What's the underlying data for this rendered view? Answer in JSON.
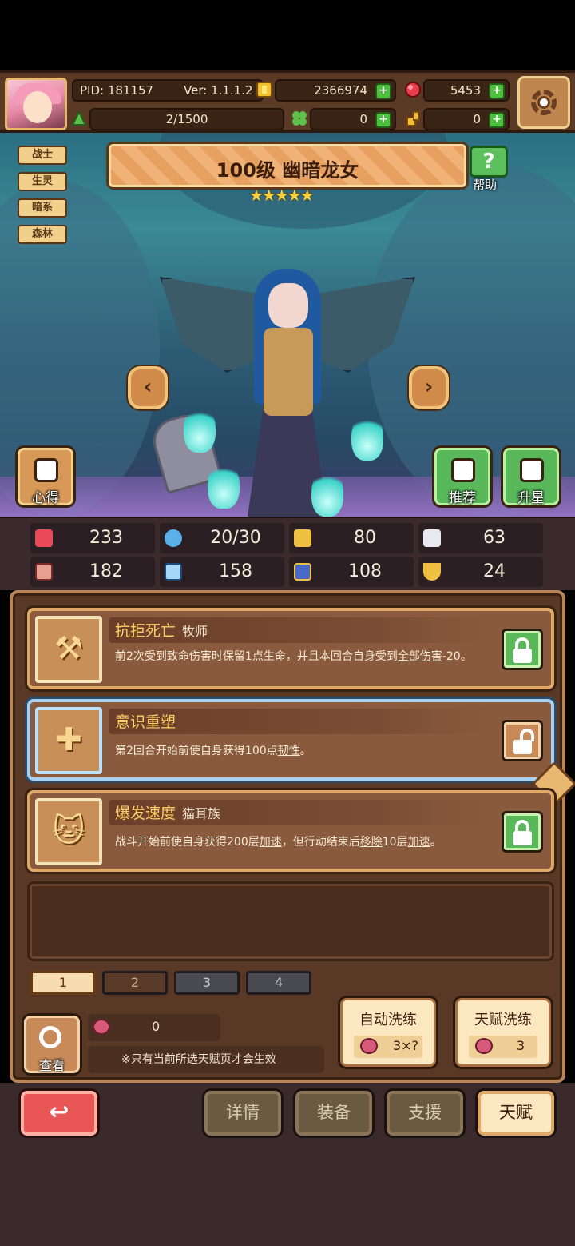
{
  "topbar": {
    "pid": "PID: 181157",
    "version": "Ver: 1.1.1.2",
    "gold": "2366974",
    "gems": "5453",
    "energy": "2/1500",
    "clover": "0",
    "key": "0"
  },
  "hero": {
    "tags": [
      "战士",
      "生灵",
      "暗系",
      "森林"
    ],
    "title": "100级  幽暗龙女",
    "stars": "★★★★★",
    "help_label": "帮助",
    "prev_arrow": "‹",
    "next_arrow": "›",
    "xinde_label": "心得",
    "recommend_label": "推荐",
    "starup_label": "升星"
  },
  "stats": {
    "hp": "233",
    "mana": "20/30",
    "armor": "80",
    "speed": "63",
    "attack": "182",
    "magic": "158",
    "shield": "108",
    "luck": "24"
  },
  "talents": [
    {
      "name": "抗拒死亡",
      "tribe": "牧师",
      "glyph": "⚒",
      "desc_a": "前2次受到致命伤害时保留1点生命，并且本回合自身受到",
      "desc_u": "全部伤害",
      "desc_b": "-20。",
      "locked": "green"
    },
    {
      "name": "意识重塑",
      "tribe": "",
      "glyph": "✚",
      "desc_a": "第2回合开始前使自身获得100点",
      "desc_u": "韧性",
      "desc_b": "。",
      "locked": "open"
    },
    {
      "name": "爆发速度",
      "tribe": "猫耳族",
      "glyph": "🐱",
      "desc_a": "战斗开始前使自身获得200层",
      "desc_u": "加速",
      "desc_b": "，但行动结束后",
      "desc_u2": "移除",
      "desc_c": "10层",
      "desc_u3": "加速",
      "desc_d": "。",
      "locked": "green"
    }
  ],
  "pages": [
    "1",
    "2",
    "3",
    "4"
  ],
  "footer": {
    "view_label": "查看",
    "fruit_count": "0",
    "note": "※只有当前所选天赋页才会生效",
    "auto_wash_label": "自动洗练",
    "auto_wash_value": "3×?",
    "talent_wash_label": "天赋洗练",
    "talent_wash_value": "3"
  },
  "nav": {
    "back": "↩",
    "details": "详情",
    "equipment": "装备",
    "support": "支援",
    "talent": "天赋"
  },
  "colors": {
    "accent_gold": "#ffcf66",
    "lock_green": "#58b85a",
    "back_red": "#e85656"
  }
}
